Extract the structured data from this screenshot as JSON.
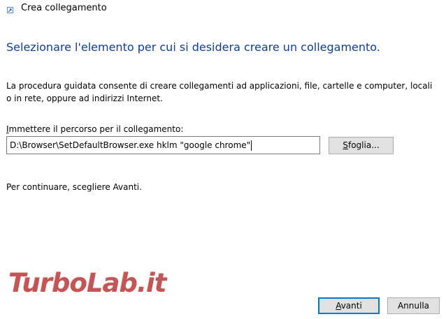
{
  "window": {
    "title": "Crea collegamento",
    "icon": "shortcut-icon"
  },
  "heading": "Selezionare l'elemento per cui si desidera creare un collegamento.",
  "description": "La procedura guidata consente di creare collegamenti ad applicazioni, file, cartelle e computer, locali o in rete, oppure ad indirizzi Internet.",
  "location": {
    "label_access_key": "I",
    "label_rest": "mmettere il percorso per il collegamento:",
    "value": "D:\\Browser\\SetDefaultBrowser.exe hklm \"google chrome\""
  },
  "browse_button": {
    "access_key": "S",
    "rest": "foglia..."
  },
  "continue_text": "Per continuare, scegliere Avanti.",
  "footer": {
    "next": {
      "access_key": "A",
      "rest": "vanti"
    },
    "cancel_label": "Annulla"
  },
  "watermark": "TurboLab.it",
  "colors": {
    "heading": "#0f3d99",
    "focus_border": "#0078d7",
    "button_face": "#e1e1e1",
    "watermark": "#b01414"
  }
}
